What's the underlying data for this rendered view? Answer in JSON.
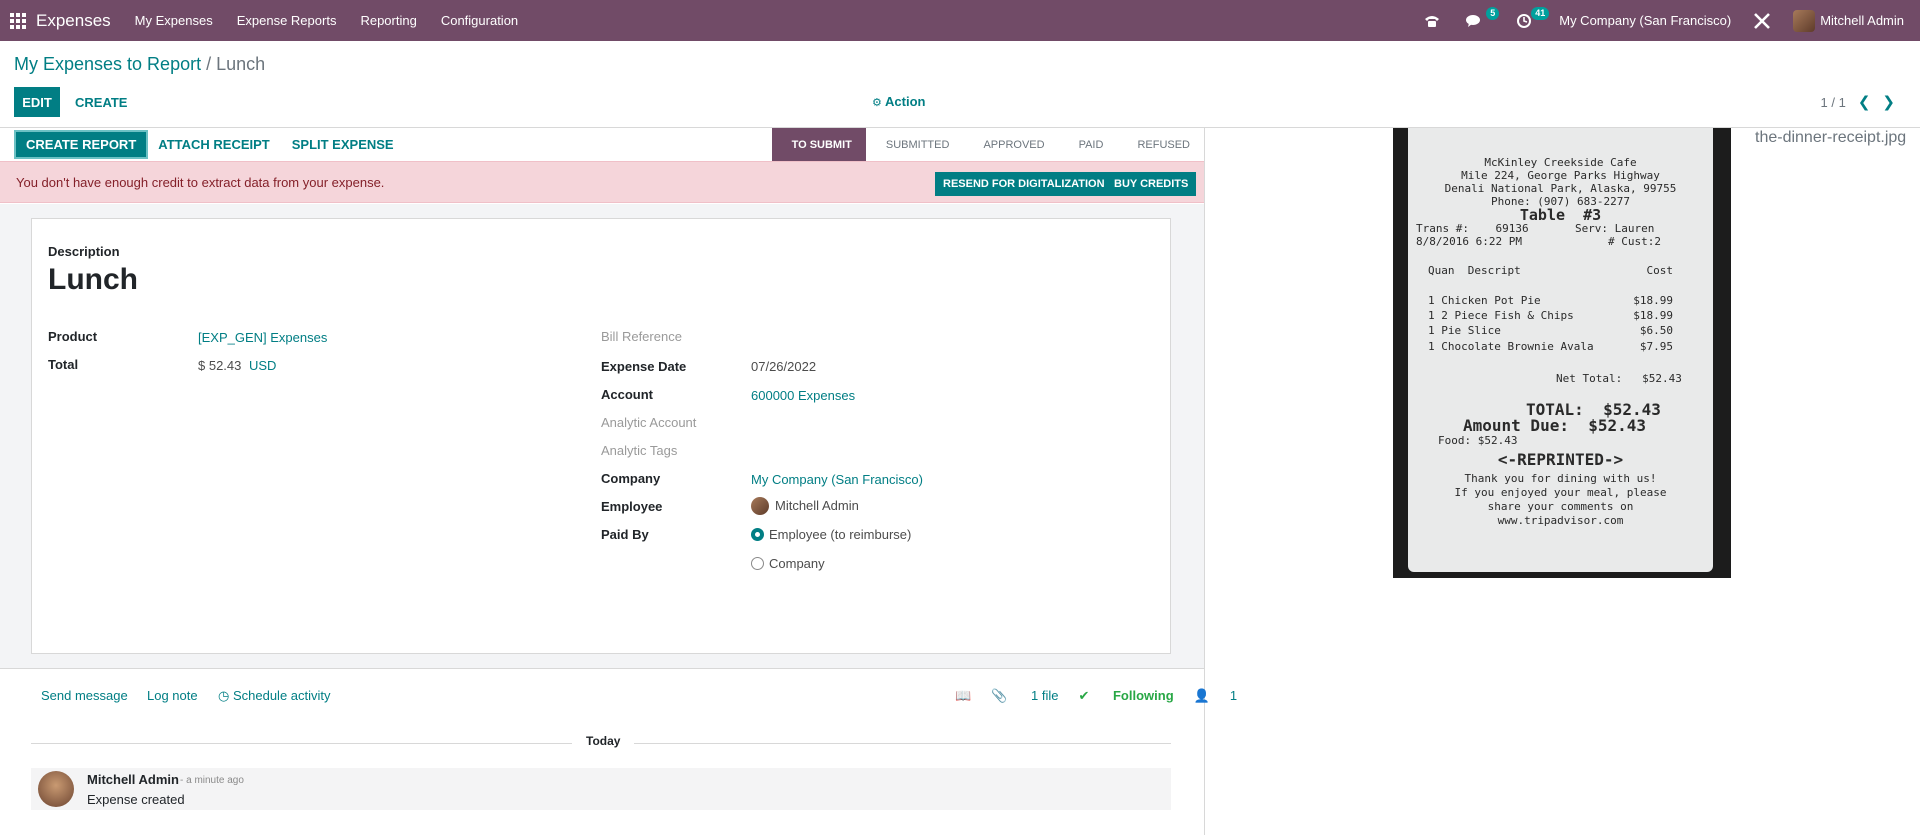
{
  "navbar": {
    "brand": "Expenses",
    "menu": [
      "My Expenses",
      "Expense Reports",
      "Reporting",
      "Configuration"
    ],
    "messages_badge": "5",
    "activities_badge": "41",
    "company": "My Company (San Francisco)",
    "user": "Mitchell Admin",
    "colors": {
      "bar": "#714b67",
      "accent": "#017e84"
    }
  },
  "breadcrumb": {
    "parent": "My Expenses to Report",
    "separator": "/",
    "current": "Lunch"
  },
  "control": {
    "edit": "EDIT",
    "create": "CREATE",
    "action": "Action",
    "pager": "1 / 1"
  },
  "statusbar": {
    "buttons": [
      "CREATE REPORT",
      "ATTACH RECEIPT",
      "SPLIT EXPENSE"
    ],
    "stages": [
      "TO SUBMIT",
      "SUBMITTED",
      "APPROVED",
      "PAID",
      "REFUSED"
    ],
    "active_stage": "TO SUBMIT"
  },
  "alert": {
    "message": "You don't have enough credit to extract data from your expense.",
    "resend": "RESEND FOR DIGITALIZATION",
    "buy": "BUY CREDITS"
  },
  "form": {
    "description_label": "Description",
    "title": "Lunch",
    "product_label": "Product",
    "product": "[EXP_GEN] Expenses",
    "total_label": "Total",
    "total_amount": "$ 52.43",
    "total_currency": "USD",
    "bill_reference_label": "Bill Reference",
    "expense_date_label": "Expense Date",
    "expense_date": "07/26/2022",
    "account_label": "Account",
    "account": "600000 Expenses",
    "analytic_account_label": "Analytic Account",
    "analytic_tags_label": "Analytic Tags",
    "company_label": "Company",
    "company": "My Company (San Francisco)",
    "employee_label": "Employee",
    "employee": "Mitchell Admin",
    "paid_by_label": "Paid By",
    "paid_by_options": [
      "Employee (to reimburse)",
      "Company"
    ],
    "paid_by_selected": "Employee (to reimburse)"
  },
  "chatter": {
    "send_message": "Send message",
    "log_note": "Log note",
    "schedule_activity": "Schedule activity",
    "files": "1 file",
    "following": "Following",
    "followers": "1",
    "today": "Today",
    "message": {
      "author": "Mitchell Admin",
      "time": "- a minute ago",
      "body": "Expense created"
    }
  },
  "attachment": {
    "filename": "the-dinner-receipt.jpg",
    "receipt_lines": [
      "McKinley Creekside Cafe",
      "Mile 224, George Parks Highway",
      "Denali National Park, Alaska, 99755",
      "Phone: (907) 683-2277",
      "Table  #3",
      "Trans #:    69136       Serv: Lauren",
      "8/8/2016 6:22 PM             # Cust:2",
      "Quan  Descript                   Cost",
      "1 Chicken Pot Pie              $18.99",
      "1 2 Piece Fish & Chips         $18.99",
      "1 Pie Slice                     $6.50",
      "1 Chocolate Brownie Avala       $7.95",
      "Net Total:   $52.43",
      "TOTAL:  $52.43",
      "Amount Due:  $52.43",
      "Food: $52.43",
      "<-REPRINTED->",
      "Thank you for dining with us!",
      "If you enjoyed your meal, please",
      "share your comments on",
      "www.tripadvisor.com"
    ]
  }
}
